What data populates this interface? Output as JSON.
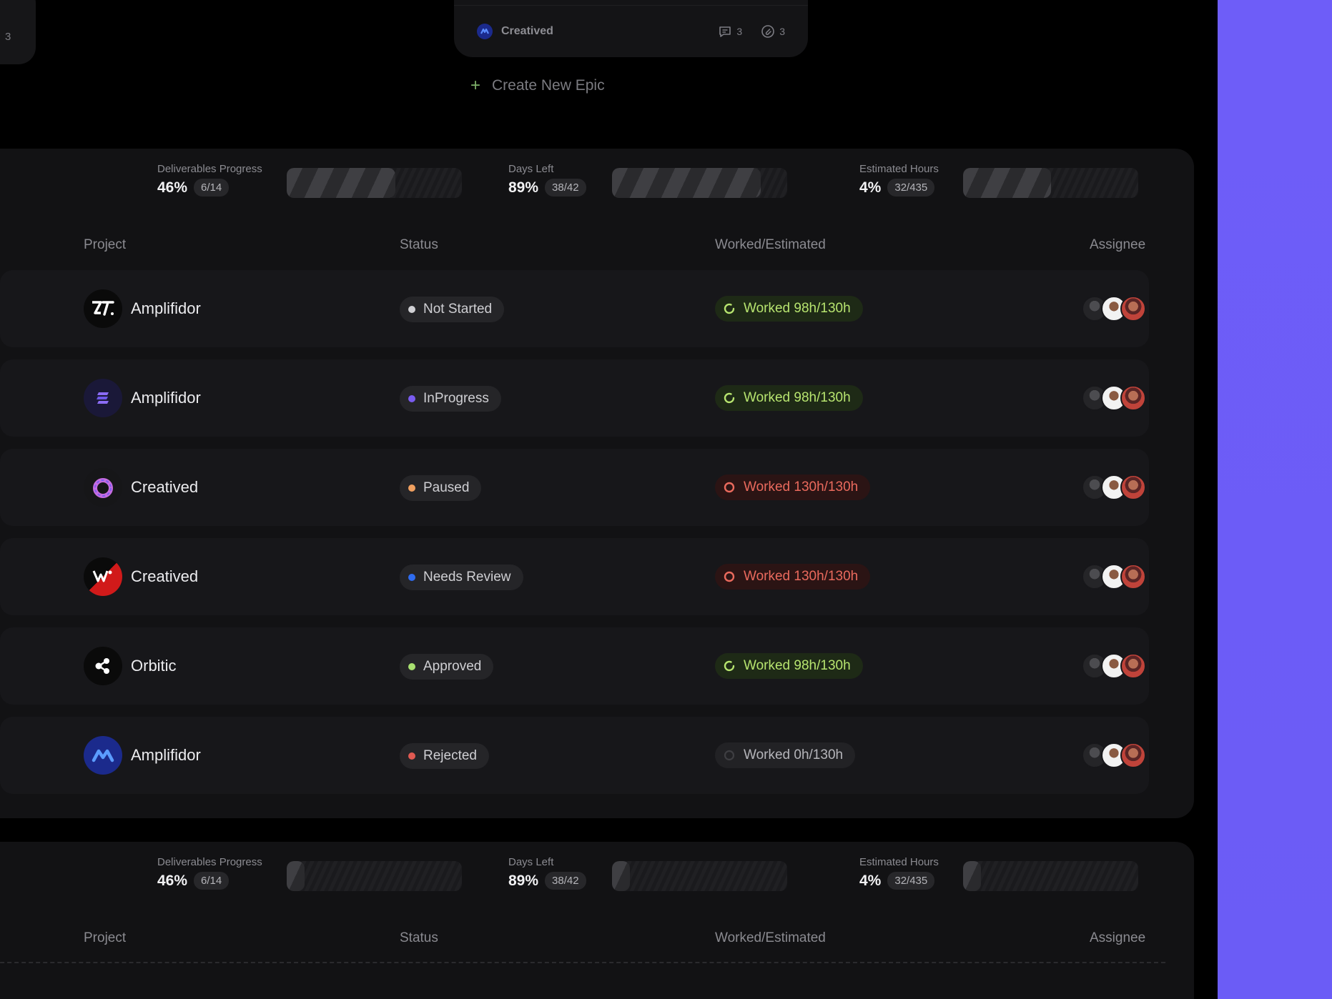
{
  "left_card": {
    "count": "3"
  },
  "epic_card": {
    "name": "Creatived",
    "comments": "3",
    "attachments": "3"
  },
  "create_epic": {
    "label": "Create New Epic"
  },
  "colors": {
    "accent_panel": "#6e5df8",
    "status_not_started": "#d0d0d4",
    "status_inprogress": "#7a5cf0",
    "status_paused": "#f0a060",
    "status_needs_review": "#2f6cf0",
    "status_approved": "#a8e070",
    "status_rejected": "#e05a52",
    "worked_ok": "#b7e46f",
    "worked_over": "#ea6a5d"
  },
  "sections": [
    {
      "stats": [
        {
          "label": "Deliverables Progress",
          "pct": "46%",
          "count": "6/14",
          "fill": 0.62
        },
        {
          "label": "Days Left",
          "pct": "89%",
          "count": "38/42",
          "fill": 0.85
        },
        {
          "label": "Estimated Hours",
          "pct": "4%",
          "count": "32/435",
          "fill": 0.5
        }
      ],
      "headers": {
        "project": "Project",
        "status": "Status",
        "worked": "Worked/Estimated",
        "assignee": "Assignee"
      },
      "rows": [
        {
          "name": "Amplifidor",
          "logo": "zt-logo-icon",
          "status": "Not Started",
          "status_key": "status_not_started",
          "worked": "Worked 98h/130h",
          "worked_state": "green"
        },
        {
          "name": "Amplifidor",
          "logo": "stripes-logo-icon",
          "status": "InProgress",
          "status_key": "status_inprogress",
          "worked": "Worked 98h/130h",
          "worked_state": "green"
        },
        {
          "name": "Creatived",
          "logo": "ring-logo-icon",
          "status": "Paused",
          "status_key": "status_paused",
          "worked": "Worked 130h/130h",
          "worked_state": "red"
        },
        {
          "name": "Creatived",
          "logo": "w-logo-icon",
          "status": "Needs Review",
          "status_key": "status_needs_review",
          "worked": "Worked 130h/130h",
          "worked_state": "red"
        },
        {
          "name": "Orbitic",
          "logo": "orbit-logo-icon",
          "status": "Approved",
          "status_key": "status_approved",
          "worked": "Worked 98h/130h",
          "worked_state": "green"
        },
        {
          "name": "Amplifidor",
          "logo": "m-logo-icon",
          "status": "Rejected",
          "status_key": "status_rejected",
          "worked": "Worked 0h/130h",
          "worked_state": "gray"
        }
      ]
    },
    {
      "stats": [
        {
          "label": "Deliverables Progress",
          "pct": "46%",
          "count": "6/14",
          "fill": 0.1
        },
        {
          "label": "Days Left",
          "pct": "89%",
          "count": "38/42",
          "fill": 0.1
        },
        {
          "label": "Estimated Hours",
          "pct": "4%",
          "count": "32/435",
          "fill": 0.1
        }
      ],
      "headers": {
        "project": "Project",
        "status": "Status",
        "worked": "Worked/Estimated",
        "assignee": "Assignee"
      }
    }
  ]
}
